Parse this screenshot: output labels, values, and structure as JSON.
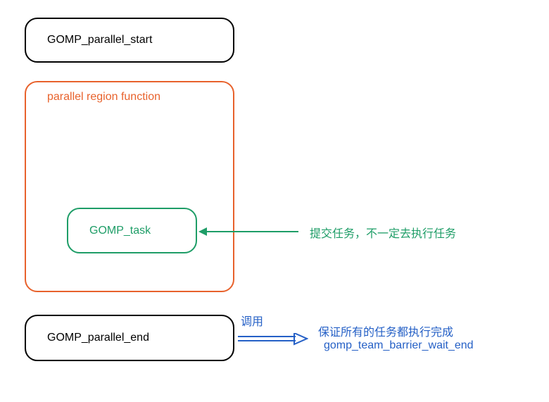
{
  "boxes": {
    "parallel_start": "GOMP_parallel_start",
    "parallel_region": "parallel region function",
    "task": "GOMP_task",
    "parallel_end": "GOMP_parallel_end"
  },
  "annotations": {
    "task_note": "提交任务，不一定去执行任务",
    "call_label": "调用",
    "end_note": "保证所有的任务都执行完成",
    "barrier_func": "gomp_team_barrier_wait_end"
  }
}
